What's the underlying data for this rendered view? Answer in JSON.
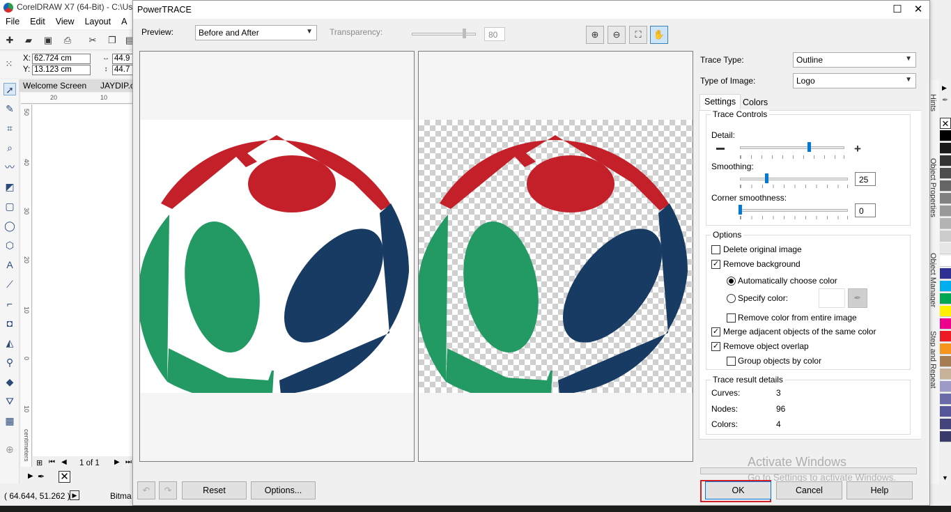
{
  "app": {
    "title": "CorelDRAW X7 (64-Bit) - C:\\Use",
    "menu": [
      "File",
      "Edit",
      "View",
      "Layout",
      "A"
    ],
    "coords": {
      "x_label": "X:",
      "x_value": "62.724 cm",
      "y_label": "Y:",
      "y_value": "13.123 cm",
      "w_value": "44.9",
      "h_value": "44.7"
    },
    "doc_tabs": [
      "Welcome Screen",
      "JAYDIP.c"
    ],
    "ruler_h_ticks": [
      "20",
      "10"
    ],
    "ruler_v_ticks": [
      "50",
      "40",
      "30",
      "20",
      "10",
      "0",
      "10"
    ],
    "ruler_unit": "centimeters",
    "page_nav": "1 of 1",
    "status_coords": "( 64.644, 51.262 )",
    "status_text": "Bitma",
    "dock_labels": [
      "Hints",
      "Object Properties",
      "Object Manager",
      "Step and Repeat"
    ],
    "palette_colors": [
      "#ffffff",
      "#000000",
      "#1a1a1a",
      "#333333",
      "#4d4d4d",
      "#666666",
      "#808080",
      "#999999",
      "#b3b3b3",
      "#cccccc",
      "#e6e6e6",
      "#ffffff",
      "#2e3192",
      "#00aeef",
      "#00a651",
      "#fff200",
      "#ec008c",
      "#ed1c24",
      "#f7941d",
      "#a67c52",
      "#c7b299",
      "#9e9ac8",
      "#6a6aa8",
      "#55559a",
      "#44447a",
      "#3a3a6a"
    ]
  },
  "dialog": {
    "title": "PowerTRACE",
    "preview_label": "Preview:",
    "preview_value": "Before and After",
    "transparency_label": "Transparency:",
    "transparency_value": "80",
    "zoom_tools": [
      {
        "name": "zoom-in-icon",
        "glyph": "⊕"
      },
      {
        "name": "zoom-out-icon",
        "glyph": "⊖"
      },
      {
        "name": "zoom-fit-icon",
        "glyph": "⛶"
      },
      {
        "name": "pan-hand-icon",
        "glyph": "✋"
      }
    ],
    "trace_type_label": "Trace Type:",
    "trace_type_value": "Outline",
    "image_type_label": "Type of Image:",
    "image_type_value": "Logo",
    "tabs": [
      "Settings",
      "Colors"
    ],
    "trace_controls": {
      "legend": "Trace Controls",
      "detail_label": "Detail:",
      "detail_level": 0.66,
      "smoothing_label": "Smoothing:",
      "smoothing_value": "25",
      "corner_label": "Corner smoothness:",
      "corner_value": "0"
    },
    "options": {
      "legend": "Options",
      "items": [
        {
          "label": "Delete original image",
          "checked": false
        },
        {
          "label": "Remove background",
          "checked": true
        },
        {
          "label": "Automatically choose color",
          "radio": true,
          "checked": true
        },
        {
          "label": "Specify color:",
          "radio": true,
          "checked": false
        },
        {
          "label": "Remove color from entire image",
          "checked": false
        },
        {
          "label": "Merge adjacent objects of the same color",
          "checked": true
        },
        {
          "label": "Remove object overlap",
          "checked": true
        },
        {
          "label": "Group objects by color",
          "checked": false
        }
      ]
    },
    "result": {
      "legend": "Trace result details",
      "rows": [
        {
          "label": "Curves:",
          "value": "3"
        },
        {
          "label": "Nodes:",
          "value": "96"
        },
        {
          "label": "Colors:",
          "value": "4"
        }
      ]
    },
    "watermark_line1": "Activate Windows",
    "watermark_line2": "Go to Settings to activate Windows.",
    "buttons": {
      "reset": "Reset",
      "options": "Options...",
      "ok": "OK",
      "cancel": "Cancel",
      "help": "Help"
    },
    "logo_colors": {
      "red": "#c4202a",
      "green": "#239963",
      "blue": "#183b63"
    },
    "ok_highlight": "#d0202a"
  }
}
